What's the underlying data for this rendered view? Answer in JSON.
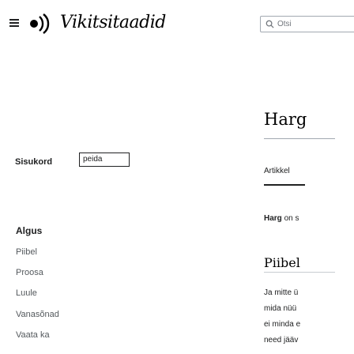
{
  "header": {
    "wordmark": "Vikitsitaadid",
    "search": {
      "placeholder": "Otsi"
    }
  },
  "language_selector": {
    "label": "Sisukord",
    "value": "peida"
  },
  "sidebar": {
    "heading": "Algus",
    "items": [
      {
        "label": "Piibel"
      },
      {
        "label": "Proosa"
      },
      {
        "label": "Luule"
      },
      {
        "label": "Vanasõnad"
      },
      {
        "label": "Vaata ka"
      }
    ]
  },
  "article": {
    "title": "Harg",
    "tab_label": "Artikkel",
    "lead_bold": "Harg",
    "lead_rest": " on s",
    "section_title": "Piibel",
    "lines": [
      "Ja mitte ü",
      "mida nüü",
      "ei minda e",
      "need jääv"
    ]
  }
}
